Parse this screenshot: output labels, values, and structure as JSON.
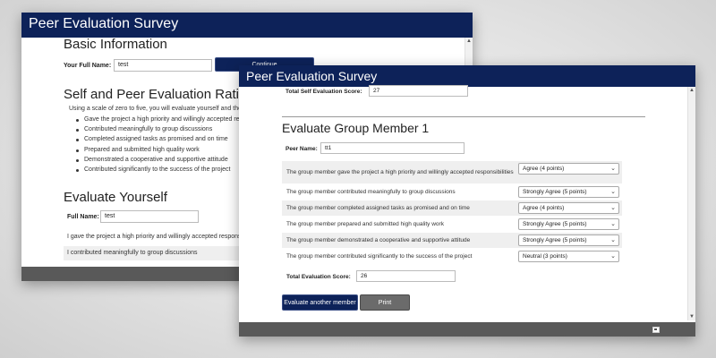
{
  "back_window": {
    "title": "Peer Evaluation Survey",
    "basic_info_heading": "Basic Information",
    "full_name_label": "Your Full Name:",
    "full_name_value": "test",
    "continue_label": "Continue",
    "ratings_heading": "Self and Peer Evaluation Ratings",
    "instructions": "Using a scale of zero to five, you will evaluate yourself and then",
    "criteria": [
      "Gave the project a high priority and willingly accepted respo",
      "Contributed meaningfully to group discussions",
      "Completed assigned tasks as promised and on time",
      "Prepared and submitted high quality work",
      "Demonstrated a cooperative and supportive attitude",
      "Contributed significantly to the success of the project"
    ],
    "evaluate_yourself_heading": "Evaluate Yourself",
    "self_name_label": "Full Name:",
    "self_name_value": "test",
    "self_rows": [
      "I gave the project a high priority and willingly accepted responsi",
      "I contributed meaningfully to group discussions"
    ]
  },
  "front_window": {
    "title": "Peer Evaluation Survey",
    "total_self_label": "Total Self Evaluation Score:",
    "total_self_value": "27",
    "group_member_heading": "Evaluate Group Member 1",
    "peer_name_label": "Peer Name:",
    "peer_name_value": "tt1",
    "questions": [
      {
        "text": "The group member gave the project a high priority and willingly accepted responsibilities",
        "rating": "Agree (4 points)"
      },
      {
        "text": "The group member contributed meaningfully to group discussions",
        "rating": "Strongly Agree (5 points)"
      },
      {
        "text": "The group member completed assigned tasks as promised and on time",
        "rating": "Agree (4 points)"
      },
      {
        "text": "The group member prepared and submitted high quality work",
        "rating": "Strongly Agree (5 points)"
      },
      {
        "text": "The group member demonstrated a cooperative and supportive attitude",
        "rating": "Strongly Agree (5 points)"
      },
      {
        "text": "The group member contributed significantly to the success of the project",
        "rating": "Neutral (3 points)"
      }
    ],
    "total_eval_label": "Total Evaluation Score:",
    "total_eval_value": "26",
    "evaluate_another_label": "Evaluate another member",
    "print_label": "Print"
  },
  "colors": {
    "titlebar": "#0d2259",
    "footer": "#595959",
    "print_button": "#6b6b6b"
  }
}
